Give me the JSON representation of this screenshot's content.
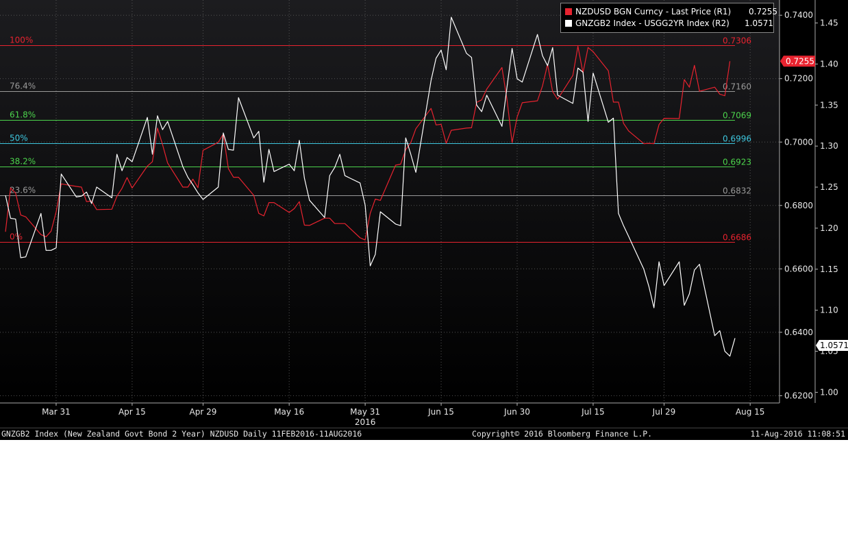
{
  "chart_data": {
    "type": "line",
    "xlabel": "",
    "year_label": "2016",
    "x_ticks": [
      "Mar 31",
      "Apr 15",
      "Apr 29",
      "May 16",
      "May 31",
      "Jun 15",
      "Jun 30",
      "Jul 15",
      "Jul 29",
      "Aug 15"
    ],
    "y_ticks_r1": [
      "0.6200",
      "0.6400",
      "0.6600",
      "0.6800",
      "0.7000",
      "0.7200",
      "0.7400"
    ],
    "y_ticks_r2": [
      "1.00",
      "1.05",
      "1.10",
      "1.15",
      "1.20",
      "1.25",
      "1.30",
      "1.35",
      "1.40",
      "1.45"
    ],
    "ylim_r1": [
      0.6177,
      0.7448
    ],
    "ylim_r2": [
      0.987,
      1.478
    ],
    "grid": true,
    "legend_position": "top-right",
    "fib_levels": [
      {
        "label": "100%",
        "value_label": "0.7306",
        "value": 0.7306,
        "color": "#e8232f"
      },
      {
        "label": "76.4%",
        "value_label": "0.7160",
        "value": 0.716,
        "color": "#9a9a9a"
      },
      {
        "label": "61.8%",
        "value_label": "0.7069",
        "value": 0.7069,
        "color": "#4cd44c"
      },
      {
        "label": "50%",
        "value_label": "0.6996",
        "value": 0.6996,
        "color": "#3ec8e0"
      },
      {
        "label": "38.2%",
        "value_label": "0.6923",
        "value": 0.6923,
        "color": "#4cd44c"
      },
      {
        "label": "23.6%",
        "value_label": "0.6832",
        "value": 0.6832,
        "color": "#9a9a9a"
      },
      {
        "label": "0%",
        "value_label": "0.6686",
        "value": 0.6686,
        "color": "#e8232f"
      }
    ],
    "series": [
      {
        "name": "NZDUSD BGN Curncy - Last Price (R1)",
        "last_label": "0.7255",
        "axis": "R1",
        "color": "#e8232f",
        "points": [
          [
            "2016-03-21",
            0.6717
          ],
          [
            "2016-03-22",
            0.6855
          ],
          [
            "2016-03-23",
            0.6839
          ],
          [
            "2016-03-24",
            0.677
          ],
          [
            "2016-03-25",
            0.6764
          ],
          [
            "2016-03-28",
            0.6708
          ],
          [
            "2016-03-29",
            0.6701
          ],
          [
            "2016-03-30",
            0.6719
          ],
          [
            "2016-03-31",
            0.678
          ],
          [
            "2016-04-01",
            0.6868
          ],
          [
            "2016-04-04",
            0.686
          ],
          [
            "2016-04-05",
            0.6858
          ],
          [
            "2016-04-06",
            0.6812
          ],
          [
            "2016-04-07",
            0.6814
          ],
          [
            "2016-04-08",
            0.6787
          ],
          [
            "2016-04-11",
            0.6788
          ],
          [
            "2016-04-12",
            0.6829
          ],
          [
            "2016-04-13",
            0.6854
          ],
          [
            "2016-04-14",
            0.6888
          ],
          [
            "2016-04-15",
            0.6855
          ],
          [
            "2016-04-18",
            0.6924
          ],
          [
            "2016-04-19",
            0.6938
          ],
          [
            "2016-04-20",
            0.7044
          ],
          [
            "2016-04-21",
            0.6992
          ],
          [
            "2016-04-22",
            0.6934
          ],
          [
            "2016-04-25",
            0.6858
          ],
          [
            "2016-04-26",
            0.6858
          ],
          [
            "2016-04-27",
            0.6883
          ],
          [
            "2016-04-28",
            0.6856
          ],
          [
            "2016-04-29",
            0.6974
          ],
          [
            "2016-05-02",
            0.6999
          ],
          [
            "2016-05-03",
            0.7025
          ],
          [
            "2016-05-04",
            0.6916
          ],
          [
            "2016-05-05",
            0.6889
          ],
          [
            "2016-05-06",
            0.6889
          ],
          [
            "2016-05-09",
            0.6832
          ],
          [
            "2016-05-10",
            0.6775
          ],
          [
            "2016-05-11",
            0.6767
          ],
          [
            "2016-05-12",
            0.6809
          ],
          [
            "2016-05-13",
            0.6809
          ],
          [
            "2016-05-16",
            0.6778
          ],
          [
            "2016-05-17",
            0.679
          ],
          [
            "2016-05-18",
            0.6812
          ],
          [
            "2016-05-19",
            0.6738
          ],
          [
            "2016-05-20",
            0.6737
          ],
          [
            "2016-05-23",
            0.676
          ],
          [
            "2016-05-24",
            0.676
          ],
          [
            "2016-05-25",
            0.6743
          ],
          [
            "2016-05-26",
            0.6743
          ],
          [
            "2016-05-27",
            0.6743
          ],
          [
            "2016-05-30",
            0.6698
          ],
          [
            "2016-05-31",
            0.6691
          ],
          [
            "2016-06-01",
            0.6775
          ],
          [
            "2016-06-02",
            0.682
          ],
          [
            "2016-06-03",
            0.6816
          ],
          [
            "2016-06-06",
            0.6927
          ],
          [
            "2016-06-07",
            0.693
          ],
          [
            "2016-06-08",
            0.6976
          ],
          [
            "2016-06-09",
            0.6998
          ],
          [
            "2016-06-10",
            0.7042
          ],
          [
            "2016-06-13",
            0.7106
          ],
          [
            "2016-06-14",
            0.7054
          ],
          [
            "2016-06-15",
            0.7056
          ],
          [
            "2016-06-16",
            0.6996
          ],
          [
            "2016-06-17",
            0.7037
          ],
          [
            "2016-06-20",
            0.7044
          ],
          [
            "2016-06-21",
            0.7045
          ],
          [
            "2016-06-22",
            0.7125
          ],
          [
            "2016-06-23",
            0.7133
          ],
          [
            "2016-06-24",
            0.7167
          ],
          [
            "2016-06-27",
            0.7235
          ],
          [
            "2016-06-28",
            0.7134
          ],
          [
            "2016-06-29",
            0.6998
          ],
          [
            "2016-06-30",
            0.7079
          ],
          [
            "2016-07-01",
            0.7124
          ],
          [
            "2016-07-04",
            0.713
          ],
          [
            "2016-07-05",
            0.7177
          ],
          [
            "2016-07-06",
            0.7245
          ],
          [
            "2016-07-07",
            0.7159
          ],
          [
            "2016-07-08",
            0.7135
          ],
          [
            "2016-07-11",
            0.721
          ],
          [
            "2016-07-12",
            0.7302
          ],
          [
            "2016-07-13",
            0.7218
          ],
          [
            "2016-07-14",
            0.7298
          ],
          [
            "2016-07-15",
            0.7285
          ],
          [
            "2016-07-18",
            0.7225
          ],
          [
            "2016-07-19",
            0.7126
          ],
          [
            "2016-07-20",
            0.7126
          ],
          [
            "2016-07-21",
            0.7059
          ],
          [
            "2016-07-22",
            0.7035
          ],
          [
            "2016-07-25",
            0.6995
          ],
          [
            "2016-07-26",
            0.6996
          ],
          [
            "2016-07-27",
            0.6995
          ],
          [
            "2016-07-28",
            0.7055
          ],
          [
            "2016-07-29",
            0.7075
          ],
          [
            "2016-08-01",
            0.7074
          ],
          [
            "2016-08-02",
            0.7197
          ],
          [
            "2016-08-03",
            0.7173
          ],
          [
            "2016-08-04",
            0.7242
          ],
          [
            "2016-08-05",
            0.716
          ],
          [
            "2016-08-08",
            0.7173
          ],
          [
            "2016-08-09",
            0.7151
          ],
          [
            "2016-08-10",
            0.7146
          ],
          [
            "2016-08-11",
            0.7255
          ]
        ]
      },
      {
        "name": "GNZGB2 Index - USGG2YR Index (R2)",
        "last_label": "1.0571",
        "axis": "R2",
        "color": "#ffffff",
        "points": [
          [
            "2016-03-21",
            1.24
          ],
          [
            "2016-03-22",
            1.212
          ],
          [
            "2016-03-23",
            1.211
          ],
          [
            "2016-03-24",
            1.164
          ],
          [
            "2016-03-25",
            1.165
          ],
          [
            "2016-03-28",
            1.218
          ],
          [
            "2016-03-29",
            1.173
          ],
          [
            "2016-03-30",
            1.173
          ],
          [
            "2016-03-31",
            1.176
          ],
          [
            "2016-04-01",
            1.266
          ],
          [
            "2016-04-04",
            1.238
          ],
          [
            "2016-04-05",
            1.239
          ],
          [
            "2016-04-06",
            1.244
          ],
          [
            "2016-04-07",
            1.23
          ],
          [
            "2016-04-08",
            1.25
          ],
          [
            "2016-04-11",
            1.237
          ],
          [
            "2016-04-12",
            1.29
          ],
          [
            "2016-04-13",
            1.27
          ],
          [
            "2016-04-14",
            1.286
          ],
          [
            "2016-04-15",
            1.281
          ],
          [
            "2016-04-18",
            1.335
          ],
          [
            "2016-04-19",
            1.29
          ],
          [
            "2016-04-20",
            1.337
          ],
          [
            "2016-04-21",
            1.32
          ],
          [
            "2016-04-22",
            1.33
          ],
          [
            "2016-04-25",
            1.275
          ],
          [
            "2016-04-26",
            1.262
          ],
          [
            "2016-04-27",
            1.253
          ],
          [
            "2016-04-28",
            1.243
          ],
          [
            "2016-04-29",
            1.235
          ],
          [
            "2016-05-02",
            1.25
          ],
          [
            "2016-05-03",
            1.316
          ],
          [
            "2016-05-04",
            1.296
          ],
          [
            "2016-05-05",
            1.295
          ],
          [
            "2016-05-06",
            1.359
          ],
          [
            "2016-05-09",
            1.31
          ],
          [
            "2016-05-10",
            1.318
          ],
          [
            "2016-05-11",
            1.256
          ],
          [
            "2016-05-12",
            1.296
          ],
          [
            "2016-05-13",
            1.269
          ],
          [
            "2016-05-16",
            1.278
          ],
          [
            "2016-05-17",
            1.27
          ],
          [
            "2016-05-18",
            1.307
          ],
          [
            "2016-05-19",
            1.261
          ],
          [
            "2016-05-20",
            1.234
          ],
          [
            "2016-05-23",
            1.213
          ],
          [
            "2016-05-24",
            1.264
          ],
          [
            "2016-05-25",
            1.274
          ],
          [
            "2016-05-26",
            1.29
          ],
          [
            "2016-05-27",
            1.264
          ],
          [
            "2016-05-30",
            1.255
          ],
          [
            "2016-05-31",
            1.228
          ],
          [
            "2016-06-01",
            1.154
          ],
          [
            "2016-06-02",
            1.168
          ],
          [
            "2016-06-03",
            1.22
          ],
          [
            "2016-06-06",
            1.205
          ],
          [
            "2016-06-07",
            1.203
          ],
          [
            "2016-06-08",
            1.31
          ],
          [
            "2016-06-09",
            1.29
          ],
          [
            "2016-06-10",
            1.268
          ],
          [
            "2016-06-13",
            1.38
          ],
          [
            "2016-06-14",
            1.407
          ],
          [
            "2016-06-15",
            1.417
          ],
          [
            "2016-06-16",
            1.393
          ],
          [
            "2016-06-17",
            1.457
          ],
          [
            "2016-06-20",
            1.413
          ],
          [
            "2016-06-21",
            1.408
          ],
          [
            "2016-06-22",
            1.35
          ],
          [
            "2016-06-23",
            1.342
          ],
          [
            "2016-06-24",
            1.362
          ],
          [
            "2016-06-27",
            1.324
          ],
          [
            "2016-06-28",
            1.372
          ],
          [
            "2016-06-29",
            1.419
          ],
          [
            "2016-06-30",
            1.382
          ],
          [
            "2016-07-01",
            1.378
          ],
          [
            "2016-07-04",
            1.436
          ],
          [
            "2016-07-05",
            1.41
          ],
          [
            "2016-07-06",
            1.398
          ],
          [
            "2016-07-07",
            1.42
          ],
          [
            "2016-07-08",
            1.362
          ],
          [
            "2016-07-11",
            1.352
          ],
          [
            "2016-07-12",
            1.395
          ],
          [
            "2016-07-13",
            1.39
          ],
          [
            "2016-07-14",
            1.33
          ],
          [
            "2016-07-15",
            1.389
          ],
          [
            "2016-07-18",
            1.329
          ],
          [
            "2016-07-19",
            1.334
          ],
          [
            "2016-07-20",
            1.218
          ],
          [
            "2016-07-21",
            1.203
          ],
          [
            "2016-07-22",
            1.19
          ],
          [
            "2016-07-25",
            1.15
          ],
          [
            "2016-07-26",
            1.129
          ],
          [
            "2016-07-27",
            1.103
          ],
          [
            "2016-07-28",
            1.159
          ],
          [
            "2016-07-29",
            1.13
          ],
          [
            "2016-08-01",
            1.159
          ],
          [
            "2016-08-02",
            1.106
          ],
          [
            "2016-08-03",
            1.12
          ],
          [
            "2016-08-04",
            1.149
          ],
          [
            "2016-08-05",
            1.156
          ],
          [
            "2016-08-08",
            1.069
          ],
          [
            "2016-08-09",
            1.075
          ],
          [
            "2016-08-10",
            1.05
          ],
          [
            "2016-08-11",
            1.044
          ],
          [
            "2016-08-12",
            1.066
          ]
        ]
      }
    ]
  },
  "footer": {
    "left": "GNZGB2 Index (New Zealand Govt Bond 2 Year) NZDUSD  Daily 11FEB2016-11AUG2016",
    "center": "Copyright© 2016 Bloomberg Finance L.P.",
    "right": "11-Aug-2016 11:08:51"
  }
}
